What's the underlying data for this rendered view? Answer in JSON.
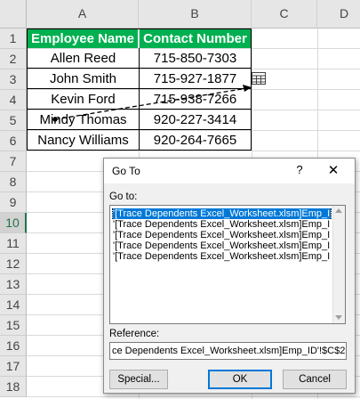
{
  "columns": [
    "A",
    "B",
    "C",
    "D"
  ],
  "rows": [
    "1",
    "2",
    "3",
    "4",
    "5",
    "6",
    "7",
    "8",
    "9",
    "10",
    "11",
    "12",
    "13",
    "14",
    "15",
    "16",
    "17",
    "18"
  ],
  "table": {
    "headers": [
      "Employee Name",
      "Contact Number"
    ],
    "data": [
      [
        "Allen Reed",
        "715-850-7303"
      ],
      [
        "John Smith",
        "715-927-1877"
      ],
      [
        "Kevin Ford",
        "715-938-7266"
      ],
      [
        "Mindy Thomas",
        "920-227-3414"
      ],
      [
        "Nancy Williams",
        "920-264-7665"
      ]
    ]
  },
  "colors": {
    "header_fill": "#00b050",
    "selected_row": "#217346",
    "dialog_bg": "#f0f0f0"
  },
  "trace_icon": "worksheet-grid-icon",
  "dialog": {
    "title": "Go To",
    "help": "?",
    "close": "✕",
    "goto_label": "Go to:",
    "items": [
      "'[Trace Dependents Excel_Worksheet.xlsm]Emp_I",
      "'[Trace Dependents Excel_Worksheet.xlsm]Emp_I",
      "'[Trace Dependents Excel_Worksheet.xlsm]Emp_I",
      "'[Trace Dependents Excel_Worksheet.xlsm]Emp_I",
      "'[Trace Dependents Excel_Worksheet.xlsm]Emp_I"
    ],
    "reference_label": "Reference:",
    "reference_value": "ce Dependents Excel_Worksheet.xlsm]Emp_ID'!$C$2",
    "buttons": {
      "special": "Special...",
      "ok": "OK",
      "cancel": "Cancel"
    }
  }
}
